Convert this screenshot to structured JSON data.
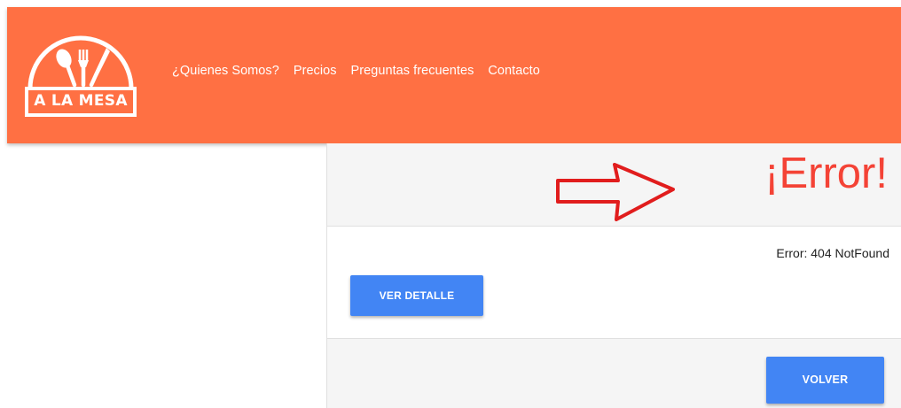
{
  "brand": {
    "logo_text": "A LA MESA"
  },
  "nav": {
    "items": [
      {
        "label": "¿Quienes Somos?"
      },
      {
        "label": "Precios"
      },
      {
        "label": "Preguntas frecuentes"
      },
      {
        "label": "Contacto"
      }
    ]
  },
  "error_card": {
    "title": "¡Error!",
    "message": "Error: 404 NotFound",
    "detail_button": "VER DETALLE",
    "back_button": "VOLVER"
  },
  "colors": {
    "navbar": "#ff7043",
    "error_title": "#f44336",
    "button": "#4285f4",
    "annotation_arrow": "#e11d1d"
  },
  "annotation": {
    "arrow_icon": "red-arrow-right-icon"
  }
}
